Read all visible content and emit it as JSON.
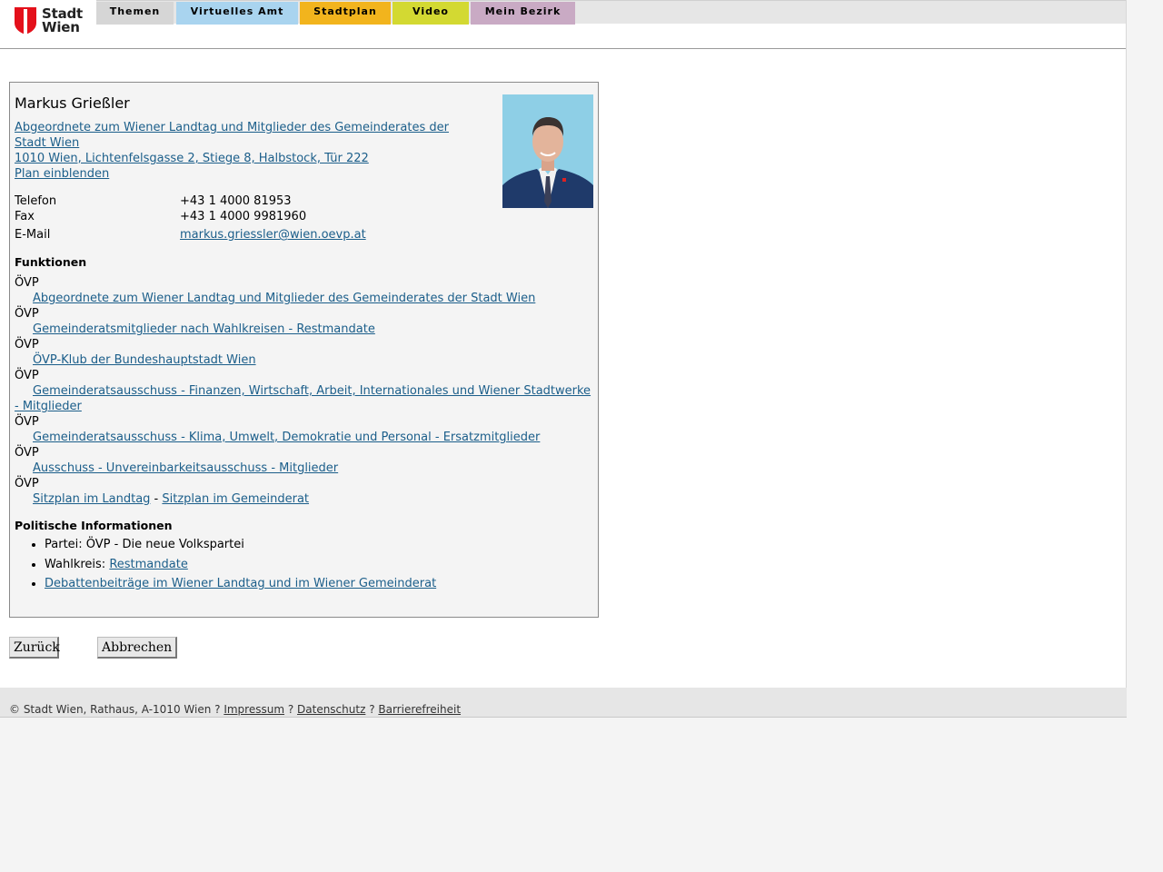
{
  "header": {
    "logo_line1": "Stadt",
    "logo_line2": "Wien",
    "nav": [
      {
        "label": "Themen",
        "color": "#d6d6d6"
      },
      {
        "label": "Virtuelles Amt",
        "color": "#a9d4ef"
      },
      {
        "label": "Stadtplan",
        "color": "#f2b41d"
      },
      {
        "label": "Video",
        "color": "#d3d932"
      },
      {
        "label": "Mein Bezirk",
        "color": "#c9aac4"
      }
    ]
  },
  "person": {
    "name": "Markus Grießler",
    "role_link": "Abgeordnete zum Wiener Landtag und Mitglieder des Gemeinderates der Stadt Wien",
    "address_link": "1010 Wien, Lichtenfelsgasse 2, Stiege 8, Halbstock, Tür 222",
    "plan_link": "Plan einblenden",
    "contact": {
      "phone_label": "Telefon",
      "phone": "+43 1 4000 81953",
      "fax_label": "Fax",
      "fax": "+43 1 4000 9981960",
      "email_label": "E-Mail",
      "email": "markus.griessler@wien.oevp.at"
    }
  },
  "functions": {
    "title": "Funktionen",
    "items": [
      {
        "party": "ÖVP",
        "link": "Abgeordnete zum Wiener Landtag und Mitglieder des Gemeinderates der Stadt Wien"
      },
      {
        "party": "ÖVP",
        "link": "Gemeinderatsmitglieder nach Wahlkreisen - Restmandate"
      },
      {
        "party": "ÖVP",
        "link": "ÖVP-Klub der Bundeshauptstadt Wien"
      },
      {
        "party": "ÖVP",
        "link": "Gemeinderatsausschuss - Finanzen, Wirtschaft, Arbeit, Internationales und Wiener Stadtwerke - Mitglieder"
      },
      {
        "party": "ÖVP",
        "link": "Gemeinderatsausschuss - Klima, Umwelt, Demokratie und Personal - Ersatzmitglieder"
      },
      {
        "party": "ÖVP",
        "link": "Ausschuss - Unvereinbarkeitsausschuss - Mitglieder"
      }
    ],
    "last": {
      "party": "ÖVP",
      "link1": "Sitzplan im Landtag",
      "sep": " - ",
      "link2": "Sitzplan im Gemeinderat"
    }
  },
  "political": {
    "title": "Politische Informationen",
    "party_text": "Partei: ÖVP - Die neue Volkspartei",
    "district_label": "Wahlkreis: ",
    "district_link": "Restmandate",
    "debates_link": "Debattenbeiträge im Wiener Landtag und im Wiener Gemeinderat"
  },
  "buttons": {
    "back": "Zurück",
    "cancel": "Abbrechen"
  },
  "footer": {
    "copyright": "© Stadt Wien, Rathaus, A-1010 Wien ? ",
    "impressum": "Impressum",
    "sep1": " ? ",
    "datenschutz": "Datenschutz",
    "sep2": " ? ",
    "barrierefreiheit": "Barrierefreiheit"
  }
}
